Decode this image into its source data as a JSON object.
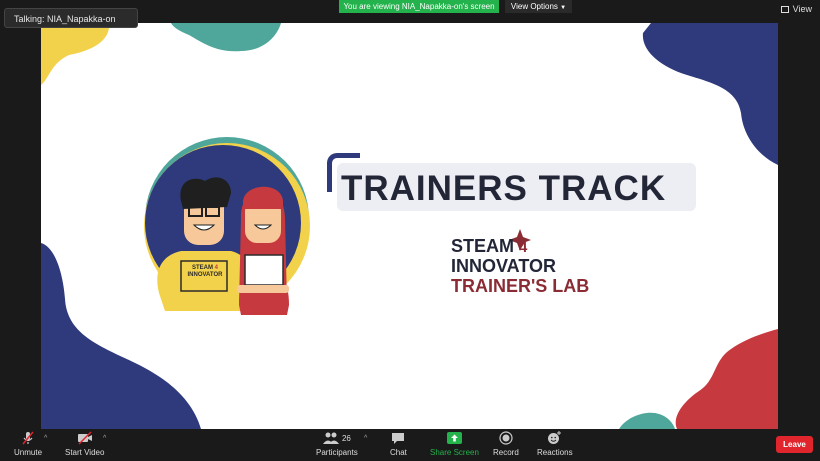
{
  "talking": "Talking: NIA_Napakka-on",
  "banner": {
    "viewing": "You are viewing NIA_Napakka-on's screen",
    "view_options": "View Options"
  },
  "view_button": "View",
  "slide": {
    "title": "TRAINERS TRACK",
    "logo_line1": "STEAM",
    "logo_number": "4",
    "logo_line2": "INNOVATOR",
    "logo_line3": "TRAINER'S LAB",
    "shirt_text_1": "STEAM",
    "shirt_text_2": "INNOVATOR",
    "shirt_number": "4"
  },
  "toolbar": {
    "unmute": "Unmute",
    "start_video": "Start Video",
    "participants": "Participants",
    "participants_count": "26",
    "chat": "Chat",
    "share_screen": "Share Screen",
    "record": "Record",
    "reactions": "Reactions",
    "leave": "Leave"
  },
  "colors": {
    "share_green": "#23b24b",
    "leave_red": "#e0262c",
    "navy": "#2f3a7c",
    "teal": "#4fa79b",
    "yellow": "#f3d24b",
    "red": "#c63a3f",
    "maroon": "#8b2b34"
  },
  "icons": [
    "microphone-muted-icon",
    "video-off-icon",
    "participants-icon",
    "chat-icon",
    "share-screen-icon",
    "record-icon",
    "reactions-icon",
    "view-grid-icon",
    "chevron-down-icon"
  ]
}
